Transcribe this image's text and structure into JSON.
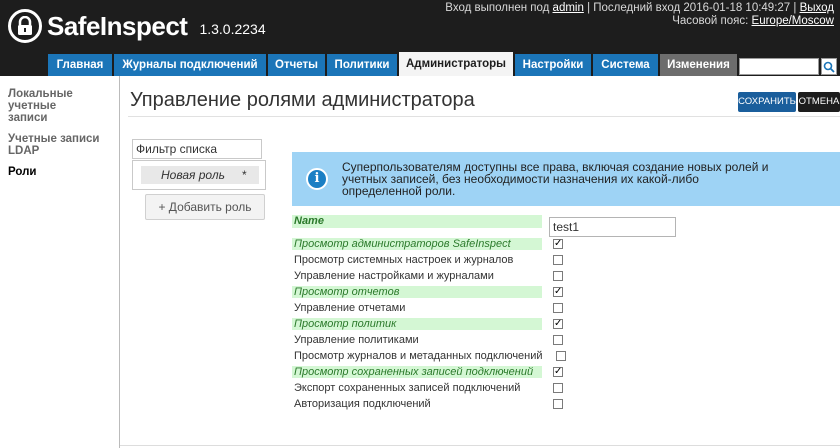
{
  "header": {
    "product_name": "SafeInspect",
    "version": "1.3.0.2234",
    "login_prefix": "Вход выполнен под",
    "user": "admin",
    "last_login_prefix": "| Последний вход 2016-01-18 10:49:27 |",
    "logout": "Выход",
    "timezone_prefix": "Часовой пояс:",
    "timezone": "Europe/Moscow"
  },
  "nav": {
    "tabs": [
      {
        "label": "Главная"
      },
      {
        "label": "Журналы подключений"
      },
      {
        "label": "Отчеты"
      },
      {
        "label": "Политики"
      },
      {
        "label": "Администраторы"
      },
      {
        "label": "Настройки"
      },
      {
        "label": "Система"
      },
      {
        "label": "Изменения"
      }
    ],
    "search_value": ""
  },
  "sidebar": {
    "items": [
      {
        "label": "Локальные учетные записи"
      },
      {
        "label": "Учетные записи LDAP"
      },
      {
        "label": "Роли"
      }
    ]
  },
  "main": {
    "title": "Управление ролями администратора",
    "save_label": "СОХРАНИТЬ",
    "cancel_label": "ОТМЕНА",
    "filter_value": "Фильтр списка",
    "role_name": "Новая роль",
    "role_marker": "*",
    "add_role_label": "+ Добавить роль",
    "info_text": "Суперпользователям доступны все права, включая создание новых ролей и учетных записей, без необходимости назначения их какой-либо определенной роли.",
    "name_label": "Name",
    "name_value": "test1",
    "check_mark": "✓",
    "permissions": [
      {
        "label": "Просмотр администраторов SafeInspect",
        "checked": true
      },
      {
        "label": "Просмотр системных настроек и журналов",
        "checked": false
      },
      {
        "label": "Управление настройками и журналами",
        "checked": false
      },
      {
        "label": "Просмотр отчетов",
        "checked": true
      },
      {
        "label": "Управление отчетами",
        "checked": false
      },
      {
        "label": "Просмотр политик",
        "checked": true
      },
      {
        "label": "Управление политиками",
        "checked": false
      },
      {
        "label": "Просмотр журналов и метаданных подключений",
        "checked": false
      },
      {
        "label": "Просмотр сохраненных записей подключений",
        "checked": true
      },
      {
        "label": "Экспорт сохраненных записей подключений",
        "checked": false
      },
      {
        "label": "Авторизация подключений",
        "checked": false
      }
    ]
  },
  "colors": {
    "accent": "#1b75b8",
    "header_bg": "#1d1d1d",
    "info_bg": "#9ed3f5",
    "checked_bg": "#d4f7d4",
    "checked_text": "#2b7a2b"
  }
}
